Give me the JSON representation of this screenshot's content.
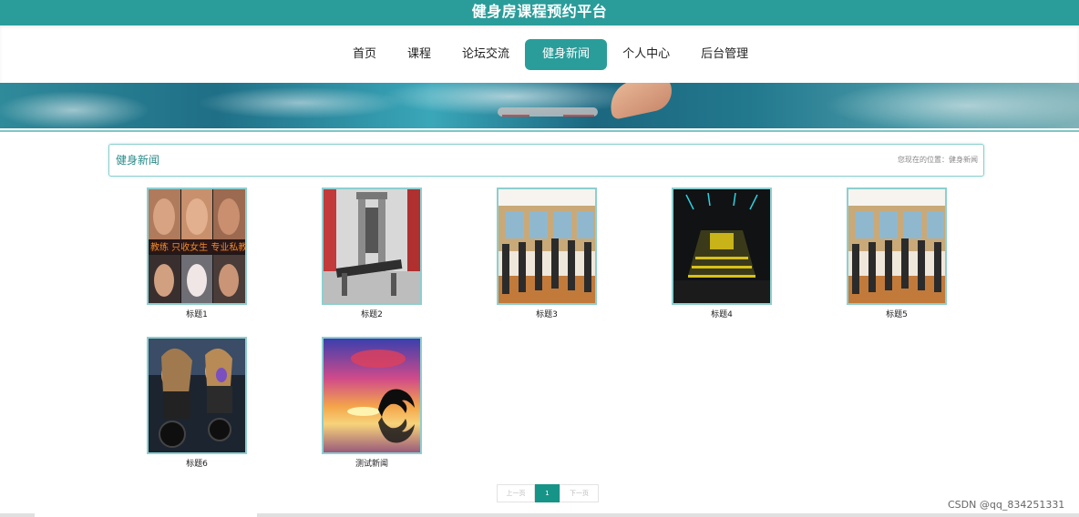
{
  "header": {
    "title": "健身房课程预约平台"
  },
  "nav": {
    "items": [
      {
        "label": "首页",
        "active": false
      },
      {
        "label": "课程",
        "active": false
      },
      {
        "label": "论坛交流",
        "active": false
      },
      {
        "label": "健身新闻",
        "active": true
      },
      {
        "label": "个人中心",
        "active": false
      },
      {
        "label": "后台管理",
        "active": false
      }
    ]
  },
  "breadcrumb": {
    "title": "健身新闻",
    "position": "您现在的位置：健身新闻"
  },
  "news": [
    {
      "caption": "标题1",
      "image": "fitness-women-collage"
    },
    {
      "caption": "标题2",
      "image": "gym-machine"
    },
    {
      "caption": "标题3",
      "image": "gym-treadmills"
    },
    {
      "caption": "标题4",
      "image": "dark-gym-hall"
    },
    {
      "caption": "标题5",
      "image": "gym-treadmills"
    },
    {
      "caption": "标题6",
      "image": "spin-class"
    },
    {
      "caption": "测试新闻",
      "image": "dolphin-sunset"
    }
  ],
  "pagination": {
    "prev": "上一页",
    "current": "1",
    "next": "下一页"
  },
  "watermark": "CSDN @qq_834251331",
  "colors": {
    "accent": "#2a9d9a",
    "pager_active": "#179488"
  }
}
